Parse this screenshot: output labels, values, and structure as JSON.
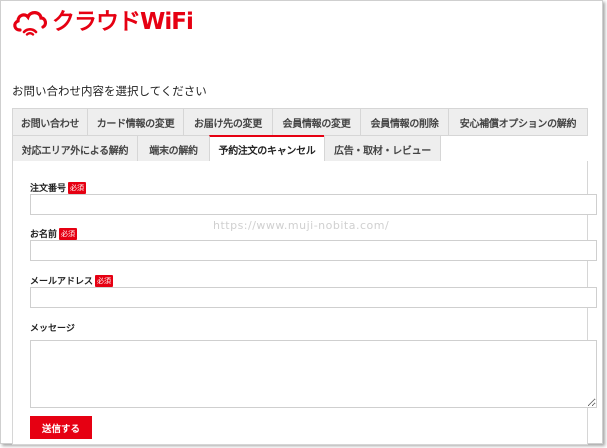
{
  "logo": {
    "text": "クラウドWiFi"
  },
  "page": {
    "heading": "お問い合わせ内容を選択してください"
  },
  "tabs_row1": [
    {
      "label": "お問い合わせ"
    },
    {
      "label": "カード情報の変更"
    },
    {
      "label": "お届け先の変更"
    },
    {
      "label": "会員情報の変更"
    },
    {
      "label": "会員情報の削除"
    },
    {
      "label": "安心補償オプションの解約"
    }
  ],
  "tabs_row2": [
    {
      "label": "対応エリア外による解約"
    },
    {
      "label": "端末の解約"
    },
    {
      "label": "予約注文のキャンセル",
      "active": true
    },
    {
      "label": "広告・取材・レビュー"
    }
  ],
  "form": {
    "order_number": {
      "label": "注文番号",
      "value": ""
    },
    "name": {
      "label": "お名前",
      "value": ""
    },
    "email": {
      "label": "メールアドレス",
      "value": ""
    },
    "message": {
      "label": "メッセージ",
      "value": ""
    },
    "required_badge": "必須",
    "submit_label": "送信する"
  },
  "watermark": "https://www.muji-nobita.com/",
  "colors": {
    "accent": "#e60012",
    "tab_bg": "#eeeeee",
    "border": "#d6d6d6"
  }
}
